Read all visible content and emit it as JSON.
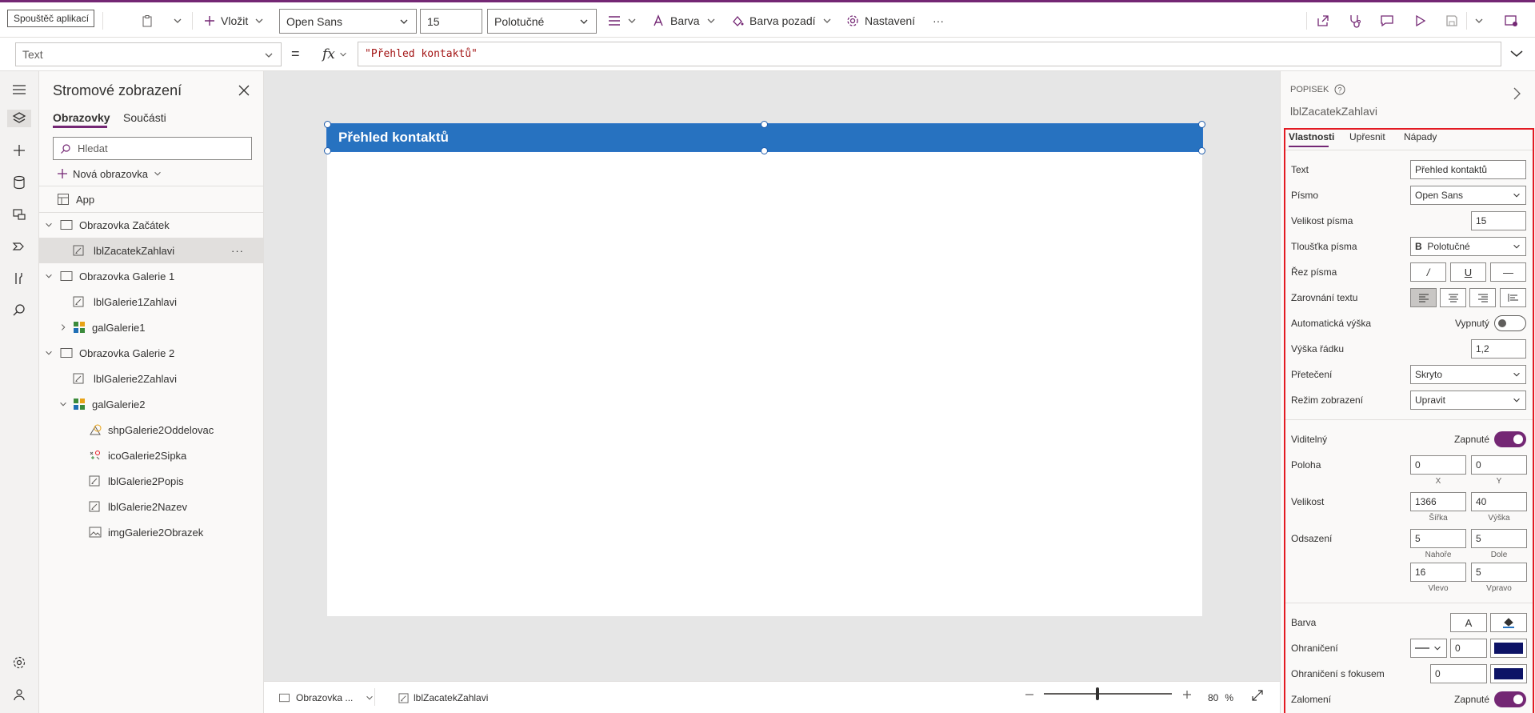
{
  "tooltip": "Spouštěč aplikací",
  "toolbar": {
    "insert_label": "Vložit",
    "font": "Open Sans",
    "font_size": "15",
    "font_weight": "Polotučné",
    "color_label": "Barva",
    "bg_color_label": "Barva pozadí",
    "settings_label": "Nastavení",
    "more_label": "···"
  },
  "formula": {
    "property": "Text",
    "equals": "=",
    "fx": "fx",
    "value": "\"Přehled kontaktů\""
  },
  "tree": {
    "title": "Stromové zobrazení",
    "tabs": [
      "Obrazovky",
      "Součásti"
    ],
    "search_placeholder": "Hledat",
    "new_screen": "Nová obrazovka",
    "items": [
      {
        "label": "App",
        "icon": "app-icon"
      },
      {
        "label": "Obrazovka Začátek",
        "icon": "screen-icon"
      },
      {
        "label": "lblZacatekZahlavi",
        "icon": "label-icon"
      },
      {
        "label": "Obrazovka Galerie 1",
        "icon": "screen-icon"
      },
      {
        "label": "lblGalerie1Zahlavi",
        "icon": "label-icon"
      },
      {
        "label": "galGalerie1",
        "icon": "gallery-icon"
      },
      {
        "label": "Obrazovka Galerie 2",
        "icon": "screen-icon"
      },
      {
        "label": "lblGalerie2Zahlavi",
        "icon": "label-icon"
      },
      {
        "label": "galGalerie2",
        "icon": "gallery-icon"
      },
      {
        "label": "shpGalerie2Oddelovac",
        "icon": "shape-icon"
      },
      {
        "label": "icoGalerie2Sipka",
        "icon": "icon-control-icon"
      },
      {
        "label": "lblGalerie2Popis",
        "icon": "label-icon"
      },
      {
        "label": "lblGalerie2Nazev",
        "icon": "label-icon"
      },
      {
        "label": "imgGalerie2Obrazek",
        "icon": "image-icon"
      }
    ],
    "row_more": "···"
  },
  "canvas": {
    "header_text": "Přehled kontaktů"
  },
  "status": {
    "screen": "Obrazovka ...",
    "control": "lblZacatekZahlavi",
    "zoom": "80",
    "zoom_unit": "%"
  },
  "props": {
    "type": "POPISEK",
    "name": "lblZacatekZahlavi",
    "tabs": [
      "Vlastnosti",
      "Upřesnit",
      "Nápady"
    ],
    "text_label": "Text",
    "text_value": "Přehled kontaktů",
    "font_label": "Písmo",
    "font_value": "Open Sans",
    "size_label": "Velikost písma",
    "size_value": "15",
    "weight_label": "Tloušťka písma",
    "weight_value": "Polotučné",
    "weight_prefix": "B",
    "style_label": "Řez písma",
    "style_italic": "/",
    "style_underline": "U",
    "style_strike": "—",
    "align_label": "Zarovnání textu",
    "autoheight_label": "Automatická výška",
    "autoheight_state": "Vypnutý",
    "lineheight_label": "Výška řádku",
    "lineheight_value": "1,2",
    "overflow_label": "Přetečení",
    "overflow_value": "Skryto",
    "mode_label": "Režim zobrazení",
    "mode_value": "Upravit",
    "visible_label": "Viditelný",
    "visible_state": "Zapnuté",
    "position_label": "Poloha",
    "pos_x": "0",
    "pos_y": "0",
    "x_label": "X",
    "y_label": "Y",
    "size2_label": "Velikost",
    "width_value": "1366",
    "height_value": "40",
    "width_label": "Šířka",
    "height_label": "Výška",
    "padding_label": "Odsazení",
    "pad_top": "5",
    "pad_bottom": "5",
    "pad_left": "16",
    "pad_right": "5",
    "top_label": "Nahoře",
    "bottom_label": "Dole",
    "left_label": "Vlevo",
    "right_label": "Vpravo",
    "color_label": "Barva",
    "color_glyph": "A",
    "border_label": "Ohraničení",
    "border_width": "0",
    "focus_border_label": "Ohraničení s fokusem",
    "focus_border_width": "0",
    "wrap_label": "Zalomení",
    "wrap_state": "Zapnuté",
    "border_color": "#0d1366",
    "accent": "#742774"
  }
}
